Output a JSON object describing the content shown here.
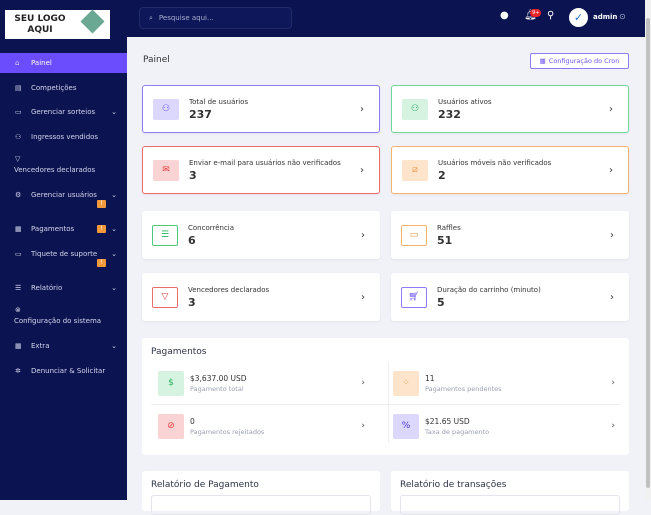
{
  "logo": {
    "text": "SEU LOGO AQUI"
  },
  "sidebar": {
    "items": [
      {
        "label": "Painel",
        "icon": "home-icon"
      },
      {
        "label": "Competições",
        "icon": "ticket-icon"
      },
      {
        "label": "Gerenciar sorteios",
        "icon": "card-icon"
      },
      {
        "label": "Ingressos vendidos",
        "icon": "user-icon"
      },
      {
        "label": "Vencedores declarados",
        "icon": "trophy-icon"
      },
      {
        "label": "Gerenciar usuários",
        "icon": "users-icon"
      },
      {
        "label": "Pagamentos",
        "icon": "receipt-icon"
      },
      {
        "label": "Tiquete de suporte",
        "icon": "ticket-icon"
      },
      {
        "label": "Relatório",
        "icon": "list-icon"
      },
      {
        "label": "Configuração do sistema",
        "icon": "gear-icon"
      },
      {
        "label": "Extra",
        "icon": "grid-icon"
      },
      {
        "label": "Denunciar & Solicitar",
        "icon": "bug-icon"
      }
    ],
    "warn": "!"
  },
  "topbar": {
    "search_placeholder": "Pesquise aqui...",
    "notif_badge": "9+",
    "user": "admin"
  },
  "page": {
    "title": "Painel",
    "cron_button": "Configuração do Cron"
  },
  "cards": [
    {
      "label": "Total de usuários",
      "value": "237"
    },
    {
      "label": "Usuários ativos",
      "value": "232"
    },
    {
      "label": "Enviar e-mail para usuários não verificados",
      "value": "3"
    },
    {
      "label": "Usuários móveis não verificados",
      "value": "2"
    },
    {
      "label": "Concorrência",
      "value": "6"
    },
    {
      "label": "Raffles",
      "value": "51"
    },
    {
      "label": "Vencedores declarados",
      "value": "3"
    },
    {
      "label": "Duração do carrinho (minuto)",
      "value": "5"
    }
  ],
  "payments": {
    "title": "Pagamentos",
    "items": [
      {
        "value": "$3,637.00 USD",
        "label": "Pagamento total"
      },
      {
        "value": "11",
        "label": "Pagamentos pendentes"
      },
      {
        "value": "0",
        "label": "Pagamentos rejeitados"
      },
      {
        "value": "$21.65 USD",
        "label": "Taxa de pagamento"
      }
    ]
  },
  "reports": {
    "payment": "Relatório de Pagamento",
    "transactions": "Relatório de transações"
  }
}
